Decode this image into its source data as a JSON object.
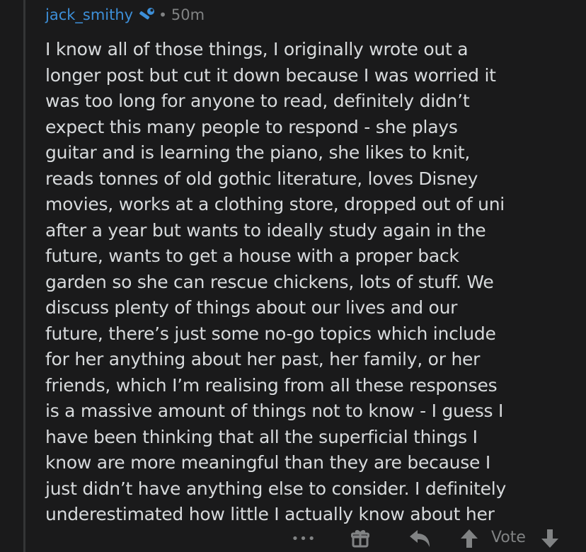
{
  "comment": {
    "author": "jack_smithy",
    "author_badge_icon": "wrench-icon",
    "separator": "•",
    "age": "50m",
    "body_lines": [
      "I know all of those things, I originally wrote out a",
      "longer post but cut it down because I was worried it",
      "was too long for anyone to read, definitely didn’t",
      "expect this many people to respond - she plays",
      "guitar and is learning the piano, she likes to knit,",
      "reads tonnes of old gothic literature, loves Disney",
      "movies, works at a clothing store, dropped out of uni",
      "after a year but wants to ideally study again in the",
      "future, wants to get a house with a proper back",
      "garden so she can rescue chickens, lots of stuff. We",
      "discuss plenty of things about our lives and our",
      "future, there’s just some no-go topics which include",
      "for her anything about her past, her family, or her",
      "friends, which I’m realising from all these responses",
      "is a massive amount of things not to know - I guess I",
      "have been thinking that all the superficial things I",
      "know are more meaningful than they are because I",
      "just didn’t have anything else to consider. I definitely",
      "underestimated how little I actually know about her"
    ]
  },
  "actions": {
    "more_label": "•••",
    "vote_label": "Vote",
    "icons": [
      "more-icon",
      "gift-icon",
      "reply-icon",
      "upvote-icon",
      "downvote-icon"
    ]
  },
  "colors": {
    "background": "#1a1a1b",
    "username": "#3d8fd8",
    "body_text": "#d7dadc",
    "muted": "#818384"
  }
}
